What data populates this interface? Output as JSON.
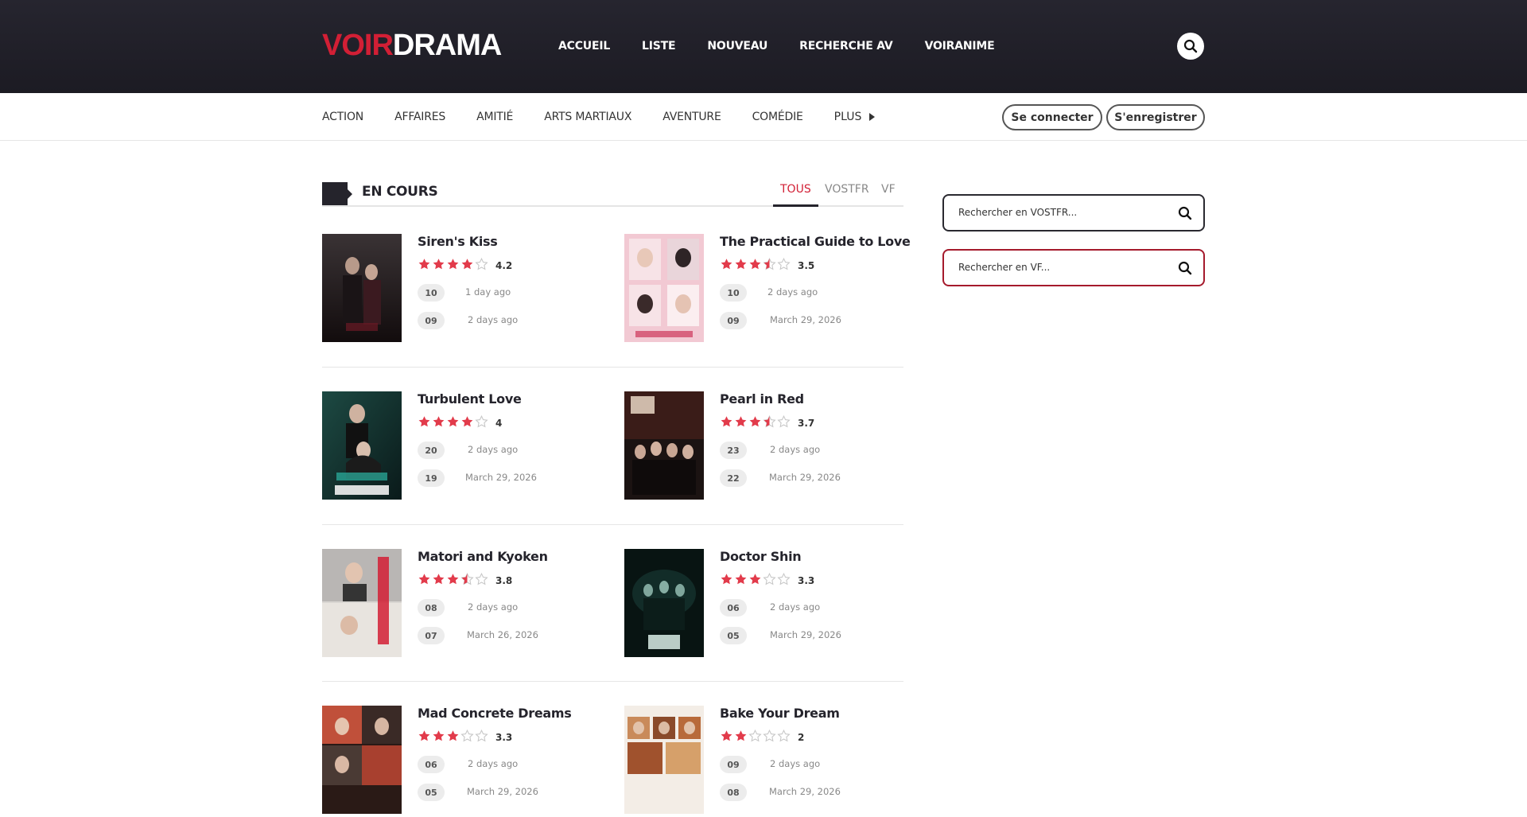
{
  "colors": {
    "accent": "#d21f35",
    "header_bg": "#1f1e26",
    "star": "#e23b4b",
    "star_empty": "#c8c8c8"
  },
  "header": {
    "logo_part1": "VOIR",
    "logo_part2": "DRAMA",
    "nav": [
      "ACCUEIL",
      "LISTE",
      "NOUVEAU",
      "RECHERCHE AV",
      "VOIRANIME"
    ],
    "search_icon": "search-icon"
  },
  "genres": {
    "items": [
      "ACTION",
      "AFFAIRES",
      "AMITIÉ",
      "ARTS MARTIAUX",
      "AVENTURE",
      "COMÉDIE"
    ],
    "more_label": "PLUS"
  },
  "auth": {
    "login": "Se connecter",
    "register": "S'enregistrer"
  },
  "section": {
    "title": "EN COURS",
    "tabs": [
      "TOUS",
      "VOSTFR",
      "VF"
    ],
    "active_tab": "TOUS"
  },
  "sidebar": {
    "search_vostfr_placeholder": "Rechercher en VOSTFR...",
    "search_vf_placeholder": "Rechercher en VF..."
  },
  "dramas": [
    {
      "title": "Siren's Kiss",
      "rating": 4.2,
      "score_label": "4.2",
      "eps": [
        {
          "num": "10",
          "date": "1 day ago"
        },
        {
          "num": "09",
          "date": "2 days ago"
        }
      ]
    },
    {
      "title": "The Practical Guide to Love",
      "rating": 3.5,
      "score_label": "3.5",
      "eps": [
        {
          "num": "10",
          "date": "2 days ago"
        },
        {
          "num": "09",
          "date": "March 29, 2026"
        }
      ]
    },
    {
      "title": "Turbulent Love",
      "rating": 4,
      "score_label": "4",
      "eps": [
        {
          "num": "20",
          "date": "2 days ago"
        },
        {
          "num": "19",
          "date": "March 29, 2026"
        }
      ]
    },
    {
      "title": "Pearl in Red",
      "rating": 3.7,
      "score_label": "3.7",
      "eps": [
        {
          "num": "23",
          "date": "2 days ago"
        },
        {
          "num": "22",
          "date": "March 29, 2026"
        }
      ]
    },
    {
      "title": "Matori and Kyoken",
      "rating": 3.8,
      "score_label": "3.8",
      "eps": [
        {
          "num": "08",
          "date": "2 days ago"
        },
        {
          "num": "07",
          "date": "March 26, 2026"
        }
      ]
    },
    {
      "title": "Doctor Shin",
      "rating": 3.3,
      "score_label": "3.3",
      "eps": [
        {
          "num": "06",
          "date": "2 days ago"
        },
        {
          "num": "05",
          "date": "March 29, 2026"
        }
      ]
    },
    {
      "title": "Mad Concrete Dreams",
      "rating": 3.3,
      "score_label": "3.3",
      "eps": [
        {
          "num": "06",
          "date": "2 days ago"
        },
        {
          "num": "05",
          "date": "March 29, 2026"
        }
      ]
    },
    {
      "title": "Bake Your Dream",
      "rating": 2,
      "score_label": "2",
      "eps": [
        {
          "num": "09",
          "date": "2 days ago"
        },
        {
          "num": "08",
          "date": "March 29, 2026"
        }
      ]
    }
  ]
}
